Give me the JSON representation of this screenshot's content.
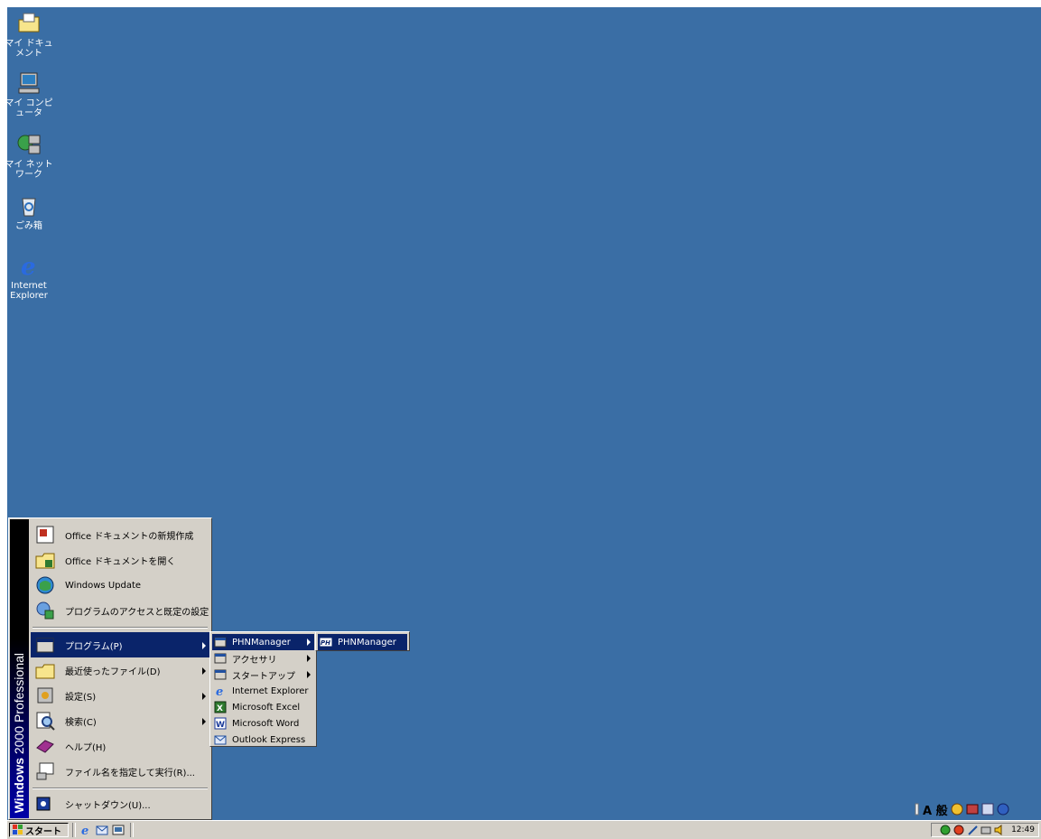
{
  "desktop": {
    "icons": [
      {
        "label": "マイ ドキュメント",
        "icon": "folder-documents-icon"
      },
      {
        "label": "マイ コンピュータ",
        "icon": "computer-icon"
      },
      {
        "label": "マイ ネットワーク",
        "icon": "network-icon"
      },
      {
        "label": "ごみ箱",
        "icon": "recycle-bin-icon"
      },
      {
        "label": "Internet Explorer",
        "icon": "internet-explorer-icon"
      }
    ]
  },
  "start_menu": {
    "banner": {
      "bold": "Windows",
      "rest": " 2000 Professional"
    },
    "items": [
      {
        "label": "Office ドキュメントの新規作成",
        "icon": "office-new-icon"
      },
      {
        "label": "Office ドキュメントを開く",
        "icon": "office-open-icon"
      },
      {
        "label": "Windows Update",
        "icon": "windows-update-icon"
      },
      {
        "label": "プログラムのアクセスと既定の設定",
        "icon": "program-defaults-icon"
      },
      {
        "label": "プログラム(P)",
        "icon": "programs-icon",
        "submenu": true
      },
      {
        "label": "最近使ったファイル(D)",
        "icon": "documents-icon",
        "submenu": true
      },
      {
        "label": "設定(S)",
        "icon": "settings-icon",
        "submenu": true
      },
      {
        "label": "検索(C)",
        "icon": "search-icon",
        "submenu": true
      },
      {
        "label": "ヘルプ(H)",
        "icon": "help-icon"
      },
      {
        "label": "ファイル名を指定して実行(R)...",
        "icon": "run-icon"
      },
      {
        "label": "シャットダウン(U)...",
        "icon": "shutdown-icon"
      }
    ]
  },
  "programs_submenu": {
    "items": [
      {
        "label": "PHNManager",
        "submenu": true
      },
      {
        "label": "アクセサリ",
        "submenu": true
      },
      {
        "label": "スタートアップ",
        "submenu": true
      },
      {
        "label": "Internet Explorer"
      },
      {
        "label": "Microsoft Excel"
      },
      {
        "label": "Microsoft Word"
      },
      {
        "label": "Outlook Express"
      }
    ]
  },
  "phnmanager_submenu": {
    "items": [
      {
        "label": "PHNManager"
      }
    ]
  },
  "taskbar": {
    "start_label": "スタート",
    "clock": "12:49"
  },
  "language_bar": {
    "text": "A 般"
  },
  "colors": {
    "desktop": "#3a6ea5",
    "highlight": "#0a246a",
    "face": "#d4d0c8"
  }
}
